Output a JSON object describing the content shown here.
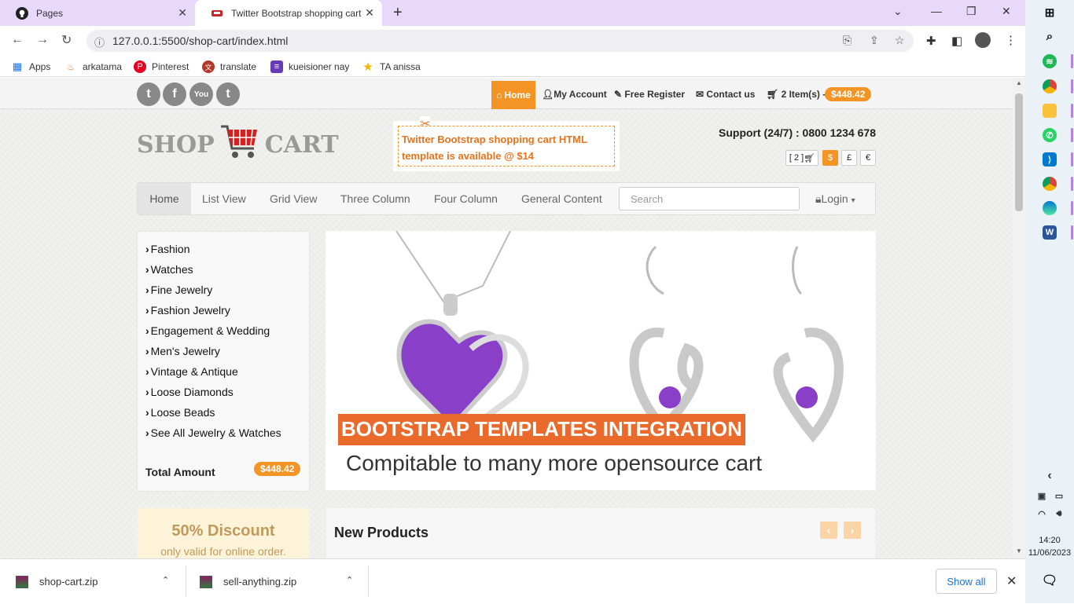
{
  "browser": {
    "tabs": [
      {
        "title": "Pages",
        "icon": "github-icon"
      },
      {
        "title": "Twitter Bootstrap shopping cart",
        "icon": "cart-favicon-icon"
      }
    ],
    "url": "127.0.0.1:5500/shop-cart/index.html",
    "bookmarks": [
      {
        "label": "Apps",
        "icon": "apps-grid-icon"
      },
      {
        "label": "arkatama",
        "icon": "arkatama-icon"
      },
      {
        "label": "Pinterest",
        "icon": "pinterest-icon"
      },
      {
        "label": "translate",
        "icon": "translate-icon"
      },
      {
        "label": "kueisioner nay",
        "icon": "forms-icon"
      },
      {
        "label": "TA anissa",
        "icon": "star-icon"
      }
    ]
  },
  "site": {
    "social": [
      {
        "icon": "twitter-icon",
        "glyph": "t"
      },
      {
        "icon": "facebook-icon",
        "glyph": "f"
      },
      {
        "icon": "youtube-icon",
        "glyph": "You"
      },
      {
        "icon": "tumblr-icon",
        "glyph": "t"
      }
    ],
    "topnav": {
      "home": "Home",
      "account": "My Account",
      "register": "Free Register",
      "contact": "Contact us",
      "cart": "2 Item(s) -",
      "cart_total": "$448.42"
    },
    "logo": {
      "left": "SHOP",
      "right": "CART"
    },
    "promo": "Twitter Bootstrap shopping cart HTML template is available @ $14",
    "support": "Support (24/7) : 0800 1234 678",
    "currency": {
      "cart": "[ 2 ]",
      "usd": "$",
      "gbp": "£",
      "eur": "€"
    },
    "mainnav": [
      "Home",
      "List View",
      "Grid View",
      "Three Column",
      "Four Column",
      "General Content"
    ],
    "search_placeholder": "Search",
    "login": "Login",
    "categories": [
      "Fashion",
      "Watches",
      "Fine Jewelry",
      "Fashion Jewelry",
      "Engagement & Wedding",
      "Men's Jewelry",
      "Vintage & Antique",
      "Loose Diamonds",
      "Loose Beads",
      "See All Jewelry & Watches"
    ],
    "total_label": "Total Amount",
    "total_value": "$448.42",
    "banner": {
      "title": "BOOTSTRAP TEMPLATES INTEGRATION",
      "subtitle": "Compitable to many more opensource cart"
    },
    "discount": {
      "title": "50% Discount",
      "subtitle": "only valid for online order."
    },
    "new_products": "New Products"
  },
  "downloads": {
    "items": [
      "shop-cart.zip",
      "sell-anything.zip"
    ],
    "show_all": "Show all"
  },
  "taskbar": {
    "time": "14:20",
    "date": "11/06/2023"
  },
  "colors": {
    "accent": "#f39425",
    "banner_title_bg": "#ea6a2b",
    "tabbar": "#e8d9fb"
  }
}
